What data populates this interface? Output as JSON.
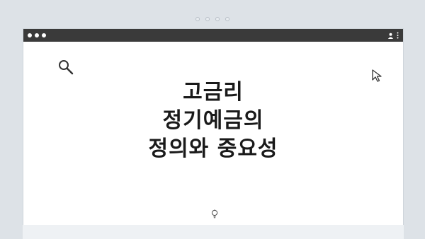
{
  "window": {
    "icons": [
      "ellipsis-icon",
      "user-icon",
      "kebab-menu-icon",
      "search-icon",
      "cursor-icon",
      "bulb-icon"
    ]
  },
  "main": {
    "title_lines": [
      "고금리",
      "정기예금의",
      "정의와 중요성"
    ]
  }
}
